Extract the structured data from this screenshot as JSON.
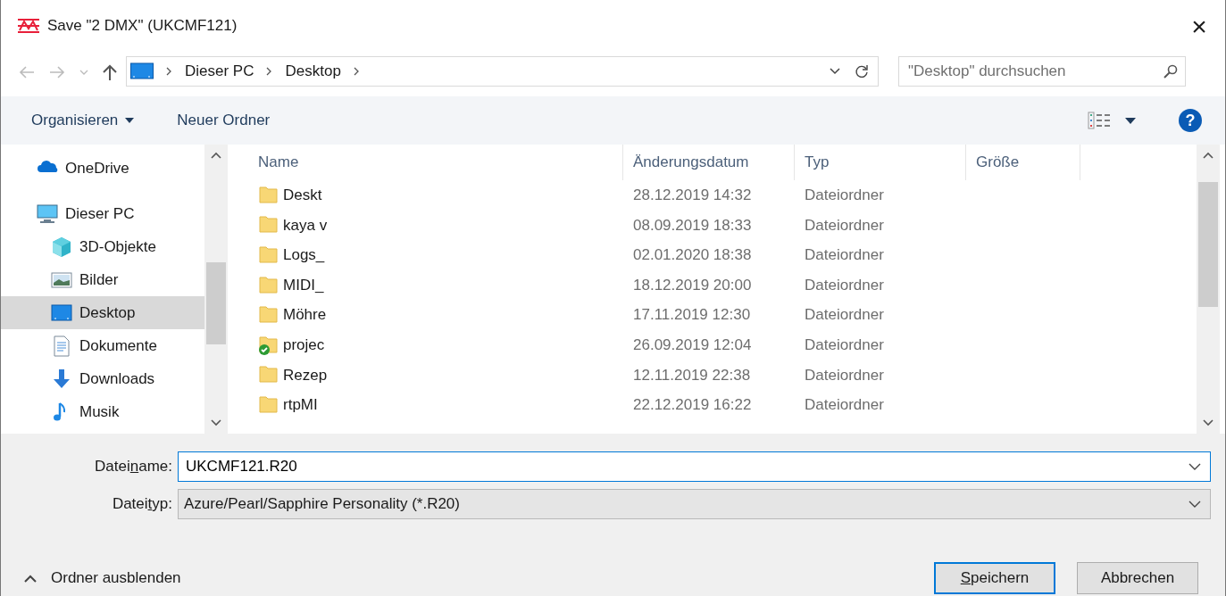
{
  "window": {
    "title": "Save \"2 DMX\" (UKCMF121)",
    "close": "×"
  },
  "address": {
    "crumbs": [
      "Dieser PC",
      "Desktop"
    ]
  },
  "search": {
    "placeholder": "\"Desktop\" durchsuchen"
  },
  "toolbar": {
    "organize": "Organisieren",
    "new_folder": "Neuer Ordner",
    "help": "?"
  },
  "sidebar": {
    "items": [
      {
        "label": "OneDrive",
        "kind": "cloud",
        "selected": false
      },
      {
        "label": "Dieser PC",
        "kind": "pc",
        "selected": false,
        "children": [
          {
            "label": "3D-Objekte",
            "kind": "cube",
            "selected": false
          },
          {
            "label": "Bilder",
            "kind": "picture",
            "selected": false
          },
          {
            "label": "Desktop",
            "kind": "desktop",
            "selected": true
          },
          {
            "label": "Dokumente",
            "kind": "document",
            "selected": false
          },
          {
            "label": "Downloads",
            "kind": "download",
            "selected": false
          },
          {
            "label": "Musik",
            "kind": "music",
            "selected": false
          }
        ]
      }
    ]
  },
  "table": {
    "columns": [
      "Name",
      "Änderungsdatum",
      "Typ",
      "Größe"
    ],
    "rows": [
      {
        "name": "Deskt",
        "date": "28.12.2019 14:32",
        "type": "Dateiordner",
        "synced": false
      },
      {
        "name": "kaya v",
        "date": "08.09.2019 18:33",
        "type": "Dateiordner",
        "synced": false
      },
      {
        "name": "Logs_",
        "date": "02.01.2020 18:38",
        "type": "Dateiordner",
        "synced": false
      },
      {
        "name": "MIDI_",
        "date": "18.12.2019 20:00",
        "type": "Dateiordner",
        "synced": false
      },
      {
        "name": "Möhre",
        "date": "17.11.2019 12:30",
        "type": "Dateiordner",
        "synced": false
      },
      {
        "name": "projec",
        "date": "26.09.2019 12:04",
        "type": "Dateiordner",
        "synced": true
      },
      {
        "name": "Rezep",
        "date": "12.11.2019 22:38",
        "type": "Dateiordner",
        "synced": false
      },
      {
        "name": "rtpMI",
        "date": "22.12.2019 16:22",
        "type": "Dateiordner",
        "synced": false
      }
    ]
  },
  "form": {
    "filename": {
      "label_before": "Datei",
      "access_key": "n",
      "label_after": "ame:",
      "value": "UKCMF121.R20"
    },
    "filetype": {
      "label_before": "Datei",
      "access_key": "t",
      "label_after": "yp:",
      "value": "Azure/Pearl/Sapphire Personality (*.R20)"
    }
  },
  "footer": {
    "hide_folders": "Ordner ausblenden",
    "buttons": [
      {
        "access_key": "S",
        "label_after": "peichern",
        "default": true
      },
      {
        "label_before": "Abbrechen",
        "default": false
      }
    ]
  }
}
